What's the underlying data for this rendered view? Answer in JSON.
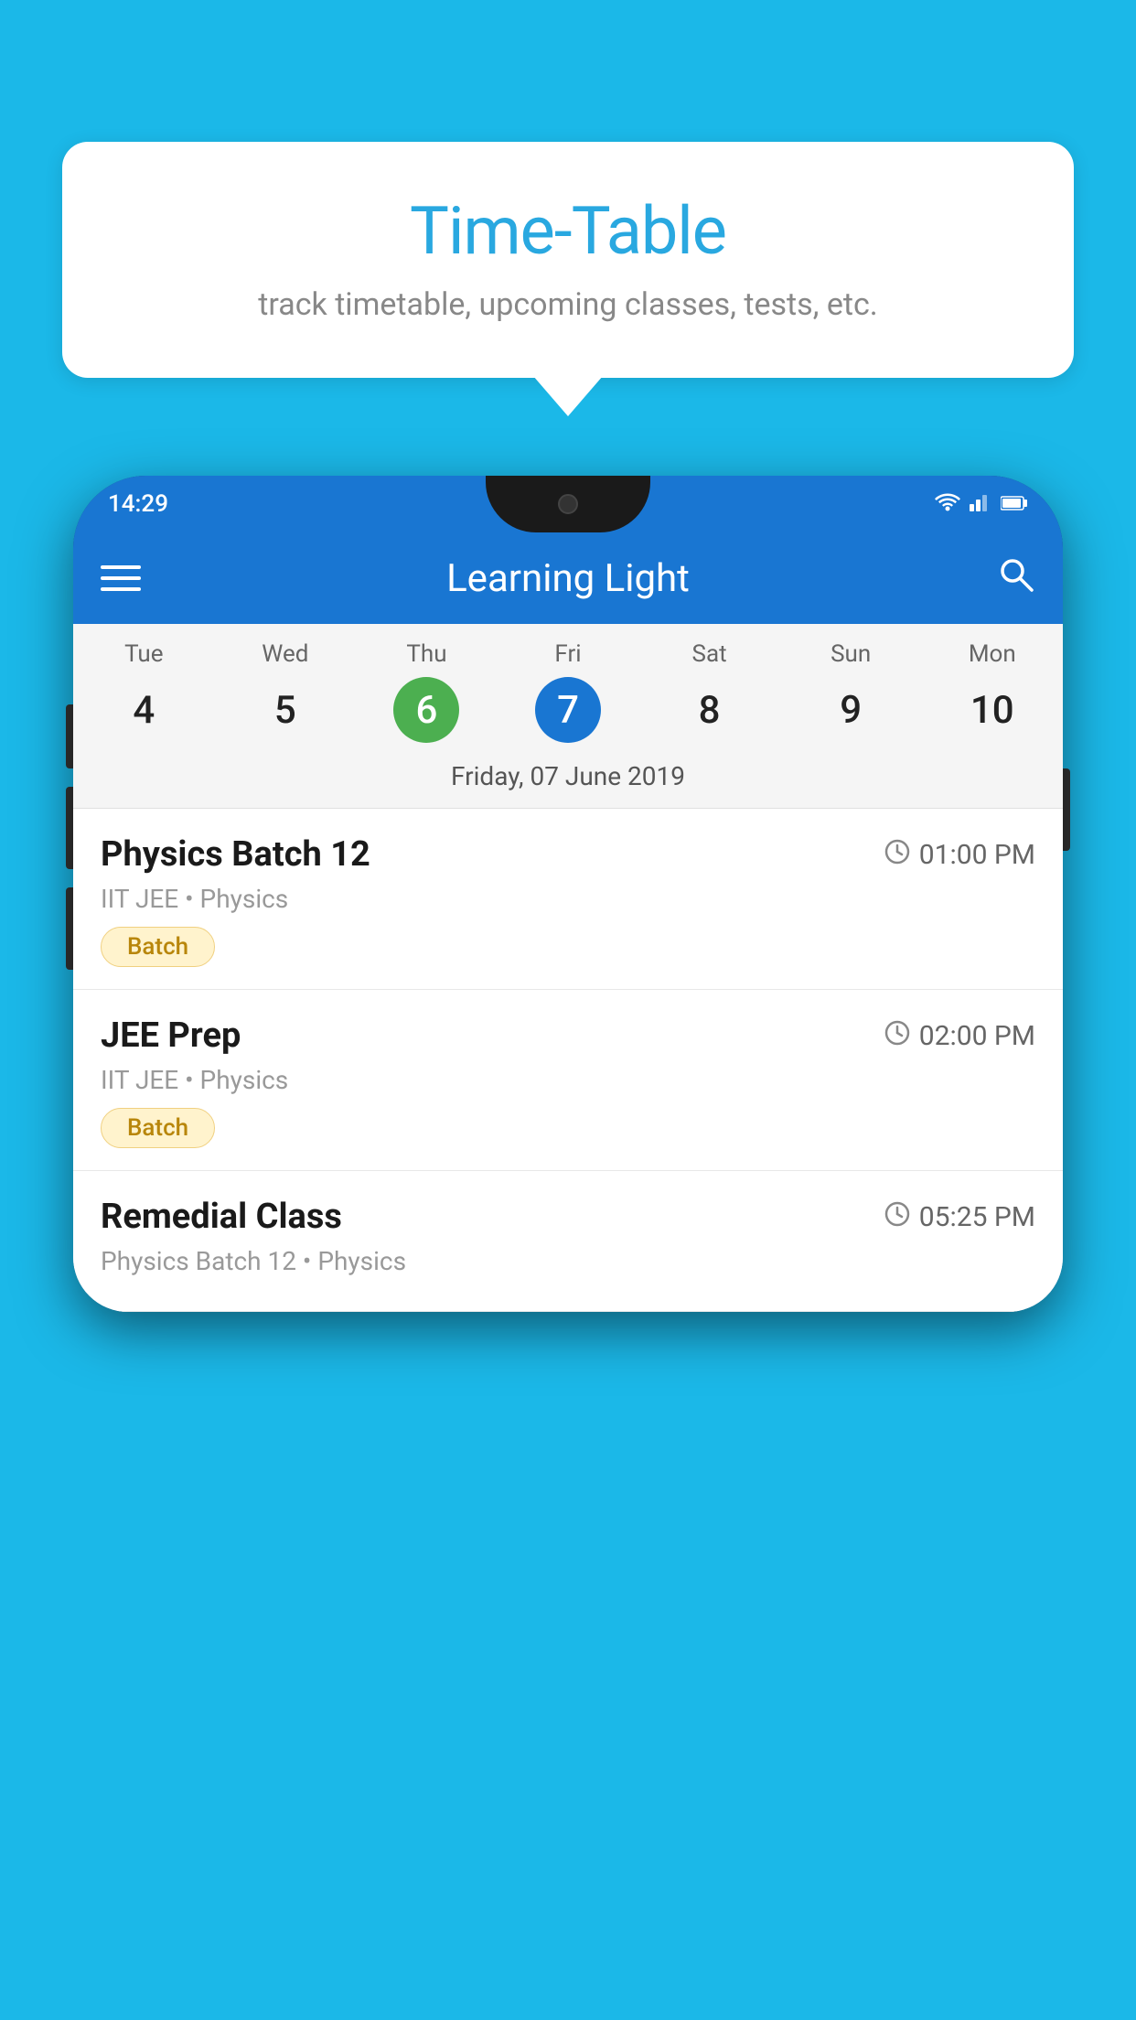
{
  "background_color": "#1bb8e8",
  "speech_bubble": {
    "title": "Time-Table",
    "subtitle": "track timetable, upcoming classes, tests, etc."
  },
  "phone": {
    "status_bar": {
      "time": "14:29",
      "icons": [
        "wifi",
        "signal",
        "battery"
      ]
    },
    "app_bar": {
      "title": "Learning Light",
      "menu_icon": "≡",
      "search_icon": "🔍"
    },
    "calendar": {
      "days": [
        {
          "label": "Tue",
          "number": "4",
          "state": "normal"
        },
        {
          "label": "Wed",
          "number": "5",
          "state": "normal"
        },
        {
          "label": "Thu",
          "number": "6",
          "state": "today"
        },
        {
          "label": "Fri",
          "number": "7",
          "state": "selected"
        },
        {
          "label": "Sat",
          "number": "8",
          "state": "normal"
        },
        {
          "label": "Sun",
          "number": "9",
          "state": "normal"
        },
        {
          "label": "Mon",
          "number": "10",
          "state": "normal"
        }
      ],
      "selected_date_label": "Friday, 07 June 2019"
    },
    "schedule": [
      {
        "title": "Physics Batch 12",
        "time": "01:00 PM",
        "subtitle": "IIT JEE • Physics",
        "tag": "Batch"
      },
      {
        "title": "JEE Prep",
        "time": "02:00 PM",
        "subtitle": "IIT JEE • Physics",
        "tag": "Batch"
      },
      {
        "title": "Remedial Class",
        "time": "05:25 PM",
        "subtitle": "Physics Batch 12 • Physics",
        "tag": null
      }
    ]
  }
}
